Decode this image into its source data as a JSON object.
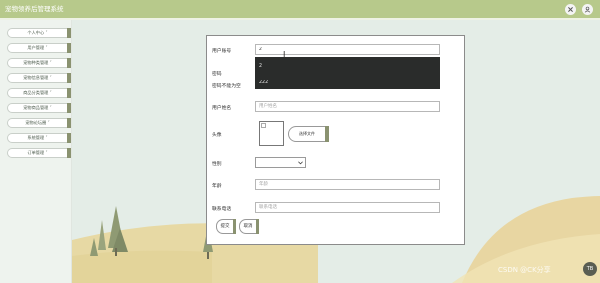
{
  "app": {
    "title": "宠物领养后管理系统"
  },
  "header": {
    "icons": [
      "expand-icon",
      "user-icon"
    ]
  },
  "sidebar": {
    "items": [
      {
        "label": "个人中心 ˅"
      },
      {
        "label": "用户管理 ˅"
      },
      {
        "label": "宠物种类管理 ˅"
      },
      {
        "label": "宠物信息管理 ˅"
      },
      {
        "label": "商品分类管理 ˅"
      },
      {
        "label": "宠物商品管理 ˅"
      },
      {
        "label": "宠物论坛圈 ˅"
      },
      {
        "label": "系统管理 ˅"
      },
      {
        "label": "订单管理 ˅"
      }
    ]
  },
  "form": {
    "account_label": "用户账号",
    "account_value": "2",
    "password_label": "密码",
    "password_error": "密码不能为空",
    "name_label": "用户姓名",
    "name_placeholder": "用户姓名",
    "avatar_label": "头像",
    "file_button": "选择文件",
    "gender_label": "性别",
    "age_label": "年龄",
    "age_placeholder": "年龄",
    "phone_label": "联系电话",
    "phone_placeholder": "联系电话",
    "submit": "提交",
    "cancel": "取消"
  },
  "autocomplete": {
    "options": [
      "2",
      "222"
    ]
  },
  "watermark": "CSDN @CK分享",
  "float_button": "TB",
  "colors": {
    "header": "#b7c98b",
    "accent": "#8a9270",
    "dropdown": "#2a2c2b"
  }
}
